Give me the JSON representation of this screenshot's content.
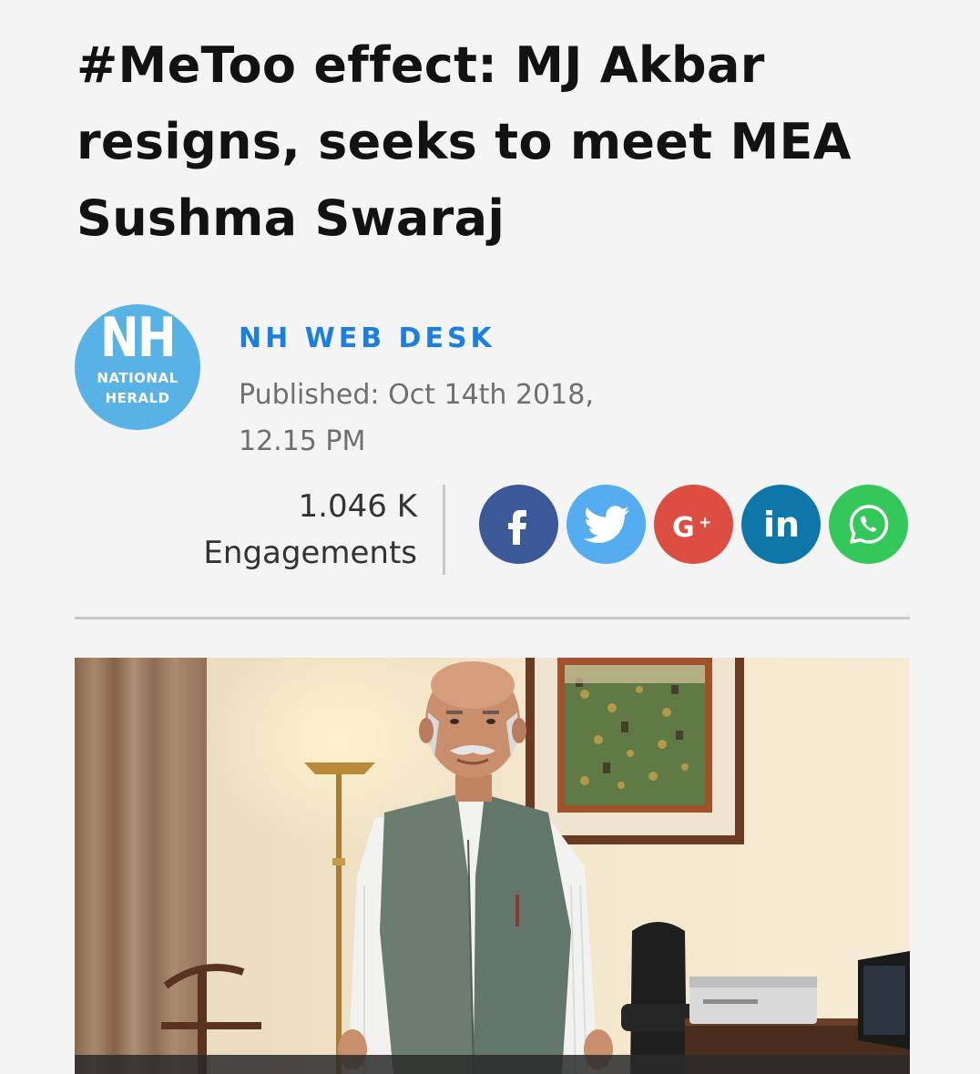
{
  "article": {
    "headline": "#MeToo effect: MJ Akbar resigns, seeks to meet MEA Sushma Swaraj",
    "author": "NH WEB DESK",
    "published": "Published: Oct 14th 2018, 12.15 PM"
  },
  "logo": {
    "main": "NH",
    "line1": "NATIONAL",
    "line2": "HERALD",
    "color": "#59b2e6"
  },
  "stats": {
    "count": "1.046 K",
    "label": "Engagements"
  },
  "share": [
    {
      "name": "facebook",
      "icon": "facebook-icon",
      "color": "#3b5998"
    },
    {
      "name": "twitter",
      "icon": "twitter-icon",
      "color": "#55acee"
    },
    {
      "name": "google-plus",
      "icon": "google-plus-icon",
      "glyph": "G+",
      "color": "#dc4e41"
    },
    {
      "name": "linkedin",
      "icon": "linkedin-icon",
      "glyph": "in",
      "color": "#0e76a8"
    },
    {
      "name": "whatsapp",
      "icon": "whatsapp-icon",
      "color": "#34c759"
    }
  ],
  "colors": {
    "author": "#1a7fe0",
    "background": "#f4f4f4"
  }
}
